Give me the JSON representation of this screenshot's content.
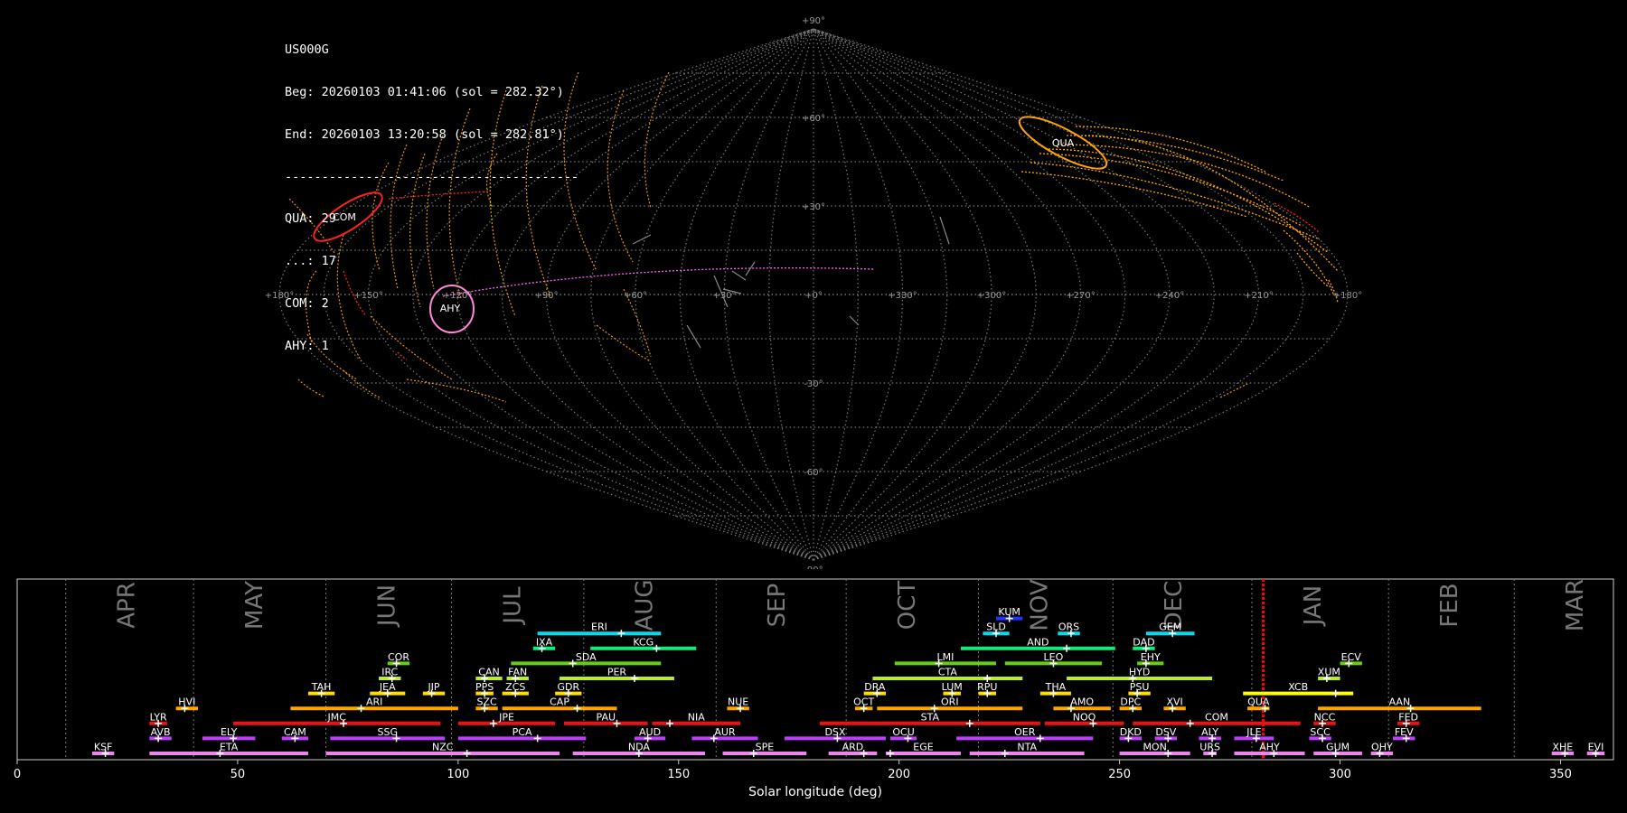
{
  "info": {
    "station": "US000G",
    "begin": "Beg: 20260103 01:41:06 (sol = 282.32°)",
    "end": "End: 20260103 13:20:58 (sol = 282.81°)",
    "divider": "----------------------------------------",
    "counts": [
      "QUA: 29",
      "...: 17",
      "COM: 2",
      "AHY: 1"
    ]
  },
  "sky": {
    "lon_labels": [
      "+180°",
      "+150°",
      "+120°",
      "+90°",
      "+60°",
      "+30°",
      "+0°",
      "+330°",
      "+300°",
      "+270°",
      "+240°",
      "+210°",
      "+180°"
    ],
    "lat_labels": [
      "+90°",
      "+60°",
      "+30°",
      "-30°",
      "-60°",
      "-90°"
    ],
    "radiants": [
      {
        "code": "QUA",
        "color": "#ffa500"
      },
      {
        "code": "COM",
        "color": "#ff2020"
      },
      {
        "code": "AHY",
        "color": "#ff88dd"
      }
    ]
  },
  "chart_data": {
    "type": "timeline",
    "xlabel": "Solar longitude (deg)",
    "xlim": [
      0,
      362
    ],
    "xticks": [
      0,
      50,
      100,
      150,
      200,
      250,
      300,
      350
    ],
    "current_sol": [
      282.32,
      282.81
    ],
    "months": [
      {
        "name": "APR",
        "boundary": 11
      },
      {
        "name": "MAY",
        "boundary": 40
      },
      {
        "name": "JUN",
        "boundary": 70
      },
      {
        "name": "JUL",
        "boundary": 98.5
      },
      {
        "name": "AUG",
        "boundary": 128.5
      },
      {
        "name": "SEP",
        "boundary": 158.5
      },
      {
        "name": "OCT",
        "boundary": 188
      },
      {
        "name": "NOV",
        "boundary": 218
      },
      {
        "name": "DEC",
        "boundary": 248.5
      },
      {
        "name": "JAN",
        "boundary": 280
      },
      {
        "name": "FEB",
        "boundary": 311
      },
      {
        "name": "MAR",
        "boundary": 339.5
      }
    ],
    "showers": [
      {
        "code": "KSF",
        "start": 17,
        "end": 22,
        "peak": 20,
        "row": 0,
        "color": "#ee82ee"
      },
      {
        "code": "ETA",
        "start": 30,
        "end": 66,
        "peak": 46,
        "row": 0,
        "color": "#ee82ee"
      },
      {
        "code": "NZC",
        "start": 70,
        "end": 123,
        "peak": 102,
        "row": 0,
        "color": "#ee82ee"
      },
      {
        "code": "NDA",
        "start": 126,
        "end": 156,
        "peak": 141,
        "row": 0,
        "color": "#ee82ee"
      },
      {
        "code": "SPE",
        "start": 160,
        "end": 179,
        "peak": 167,
        "row": 0,
        "color": "#ee82ee"
      },
      {
        "code": "ARD",
        "start": 184,
        "end": 195,
        "peak": 192,
        "row": 0,
        "color": "#ee82ee"
      },
      {
        "code": "EGE",
        "start": 197,
        "end": 214,
        "peak": 198,
        "row": 0,
        "color": "#ee82ee"
      },
      {
        "code": "NTA",
        "start": 216,
        "end": 242,
        "peak": 224,
        "row": 0,
        "color": "#ee82ee"
      },
      {
        "code": "MON",
        "start": 250,
        "end": 266,
        "peak": 261,
        "row": 0,
        "color": "#ee82ee"
      },
      {
        "code": "URS",
        "start": 269,
        "end": 272,
        "peak": 271,
        "row": 0,
        "color": "#ee82ee"
      },
      {
        "code": "AHY",
        "start": 276,
        "end": 292,
        "peak": 285,
        "row": 0,
        "color": "#ee82ee"
      },
      {
        "code": "GUM",
        "start": 294,
        "end": 305,
        "peak": 299,
        "row": 0,
        "color": "#ee82ee"
      },
      {
        "code": "OHY",
        "start": 307,
        "end": 312,
        "peak": 309,
        "row": 0,
        "color": "#ee82ee"
      },
      {
        "code": "XHE",
        "start": 348,
        "end": 353,
        "peak": 351,
        "row": 0,
        "color": "#ee82ee"
      },
      {
        "code": "EVI",
        "start": 356,
        "end": 360,
        "peak": 358,
        "row": 0,
        "color": "#ee82ee"
      },
      {
        "code": "AVB",
        "start": 30,
        "end": 35,
        "peak": 32,
        "row": 1,
        "color": "#c03cff"
      },
      {
        "code": "ELY",
        "start": 42,
        "end": 54,
        "peak": 49,
        "row": 1,
        "color": "#c03cff"
      },
      {
        "code": "CAM",
        "start": 60,
        "end": 66,
        "peak": 63,
        "row": 1,
        "color": "#c03cff"
      },
      {
        "code": "SSG",
        "start": 71,
        "end": 97,
        "peak": 86,
        "row": 1,
        "color": "#c03cff"
      },
      {
        "code": "PCA",
        "start": 100,
        "end": 129,
        "peak": 118,
        "row": 1,
        "color": "#c03cff"
      },
      {
        "code": "AUD",
        "start": 140,
        "end": 147,
        "peak": 143,
        "row": 1,
        "color": "#c03cff"
      },
      {
        "code": "AUR",
        "start": 153,
        "end": 168,
        "peak": 158,
        "row": 1,
        "color": "#c03cff"
      },
      {
        "code": "DSX",
        "start": 174,
        "end": 197,
        "peak": 186,
        "row": 1,
        "color": "#c03cff"
      },
      {
        "code": "OCU",
        "start": 198,
        "end": 204,
        "peak": 202,
        "row": 1,
        "color": "#c03cff"
      },
      {
        "code": "OER",
        "start": 213,
        "end": 244,
        "peak": 232,
        "row": 1,
        "color": "#c03cff"
      },
      {
        "code": "DKD",
        "start": 250,
        "end": 255,
        "peak": 252,
        "row": 1,
        "color": "#c03cff"
      },
      {
        "code": "DSV",
        "start": 258,
        "end": 263,
        "peak": 261,
        "row": 1,
        "color": "#c03cff"
      },
      {
        "code": "ALY",
        "start": 268,
        "end": 273,
        "peak": 271,
        "row": 1,
        "color": "#c03cff"
      },
      {
        "code": "JLE",
        "start": 276,
        "end": 285,
        "peak": 281,
        "row": 1,
        "color": "#c03cff"
      },
      {
        "code": "SCC",
        "start": 293,
        "end": 298,
        "peak": 296,
        "row": 1,
        "color": "#c03cff"
      },
      {
        "code": "FEV",
        "start": 312,
        "end": 317,
        "peak": 315,
        "row": 1,
        "color": "#c03cff"
      },
      {
        "code": "LYR",
        "start": 30,
        "end": 34,
        "peak": 32,
        "row": 2,
        "color": "#ee1111"
      },
      {
        "code": "JMC",
        "start": 49,
        "end": 96,
        "peak": 74,
        "row": 2,
        "color": "#ee1111"
      },
      {
        "code": "JPE",
        "start": 100,
        "end": 122,
        "peak": 108,
        "row": 2,
        "color": "#ee1111"
      },
      {
        "code": "PAU",
        "start": 124,
        "end": 143,
        "peak": 136,
        "row": 2,
        "color": "#ee1111"
      },
      {
        "code": "NIA",
        "start": 144,
        "end": 164,
        "peak": 148,
        "row": 2,
        "color": "#ee1111"
      },
      {
        "code": "STA",
        "start": 182,
        "end": 232,
        "peak": 216,
        "row": 2,
        "color": "#ee1111"
      },
      {
        "code": "NOO",
        "start": 233,
        "end": 251,
        "peak": 244,
        "row": 2,
        "color": "#ee1111"
      },
      {
        "code": "COM",
        "start": 253,
        "end": 291,
        "peak": 266,
        "row": 2,
        "color": "#ee1111"
      },
      {
        "code": "NCC",
        "start": 294,
        "end": 299,
        "peak": 296,
        "row": 2,
        "color": "#ee1111"
      },
      {
        "code": "FED",
        "start": 313,
        "end": 318,
        "peak": 315,
        "row": 2,
        "color": "#ee1111"
      },
      {
        "code": "HVI",
        "start": 36,
        "end": 41,
        "peak": 38,
        "row": 3,
        "color": "#ffa500"
      },
      {
        "code": "ARI",
        "start": 62,
        "end": 100,
        "peak": 78,
        "row": 3,
        "color": "#ffa500"
      },
      {
        "code": "SZC",
        "start": 104,
        "end": 109,
        "peak": 106,
        "row": 3,
        "color": "#ffa500"
      },
      {
        "code": "CAP",
        "start": 110,
        "end": 136,
        "peak": 127,
        "row": 3,
        "color": "#ffa500"
      },
      {
        "code": "NUE",
        "start": 161,
        "end": 166,
        "peak": 164,
        "row": 3,
        "color": "#ffa500"
      },
      {
        "code": "OCT",
        "start": 190,
        "end": 194,
        "peak": 192,
        "row": 3,
        "color": "#ffa500"
      },
      {
        "code": "ORI",
        "start": 195,
        "end": 228,
        "peak": 208,
        "row": 3,
        "color": "#ffa500"
      },
      {
        "code": "AMO",
        "start": 235,
        "end": 248,
        "peak": 239,
        "row": 3,
        "color": "#ffa500"
      },
      {
        "code": "DPC",
        "start": 250,
        "end": 255,
        "peak": 253,
        "row": 3,
        "color": "#ffa500"
      },
      {
        "code": "XVI",
        "start": 260,
        "end": 265,
        "peak": 262,
        "row": 3,
        "color": "#ffa500"
      },
      {
        "code": "QUA",
        "start": 279,
        "end": 284,
        "peak": 283,
        "row": 3,
        "color": "#ffa500"
      },
      {
        "code": "AAN",
        "start": 295,
        "end": 332,
        "peak": 316,
        "row": 3,
        "color": "#ffa500"
      },
      {
        "code": "TAH",
        "start": 66,
        "end": 72,
        "peak": 69,
        "row": 4,
        "color": "#ffdd00"
      },
      {
        "code": "JEA",
        "start": 80,
        "end": 88,
        "peak": 84,
        "row": 4,
        "color": "#ffdd00"
      },
      {
        "code": "JIP",
        "start": 92,
        "end": 97,
        "peak": 94,
        "row": 4,
        "color": "#ffdd00"
      },
      {
        "code": "PPS",
        "start": 104,
        "end": 108,
        "peak": 106,
        "row": 4,
        "color": "#ffdd00"
      },
      {
        "code": "ZCS",
        "start": 110,
        "end": 116,
        "peak": 113,
        "row": 4,
        "color": "#ffdd00"
      },
      {
        "code": "GDR",
        "start": 122,
        "end": 128,
        "peak": 125,
        "row": 4,
        "color": "#ffdd00"
      },
      {
        "code": "DRA",
        "start": 192,
        "end": 197,
        "peak": 195,
        "row": 4,
        "color": "#ffdd00"
      },
      {
        "code": "LUM",
        "start": 210,
        "end": 214,
        "peak": 212,
        "row": 4,
        "color": "#ffdd00"
      },
      {
        "code": "RPU",
        "start": 218,
        "end": 222,
        "peak": 220,
        "row": 4,
        "color": "#ffdd00"
      },
      {
        "code": "THA",
        "start": 232,
        "end": 239,
        "peak": 235,
        "row": 4,
        "color": "#ffdd00"
      },
      {
        "code": "PSU",
        "start": 252,
        "end": 257,
        "peak": 254,
        "row": 4,
        "color": "#ffdd00"
      },
      {
        "code": "XCB",
        "start": 278,
        "end": 303,
        "peak": 299,
        "row": 4,
        "color": "#ffff00"
      },
      {
        "code": "IRC",
        "start": 82,
        "end": 87,
        "peak": 85,
        "row": 5,
        "color": "#bbee22"
      },
      {
        "code": "CAN",
        "start": 104,
        "end": 110,
        "peak": 106,
        "row": 5,
        "color": "#bbee22"
      },
      {
        "code": "FAN",
        "start": 111,
        "end": 116,
        "peak": 113,
        "row": 5,
        "color": "#bbee22"
      },
      {
        "code": "PER",
        "start": 123,
        "end": 149,
        "peak": 140,
        "row": 5,
        "color": "#bbee22"
      },
      {
        "code": "CTA",
        "start": 194,
        "end": 228,
        "peak": 220,
        "row": 5,
        "color": "#bbee22"
      },
      {
        "code": "HYD",
        "start": 238,
        "end": 271,
        "peak": 253,
        "row": 5,
        "color": "#bbee22"
      },
      {
        "code": "XUM",
        "start": 295,
        "end": 300,
        "peak": 297,
        "row": 5,
        "color": "#bbee22"
      },
      {
        "code": "COR",
        "start": 84,
        "end": 89,
        "peak": 86,
        "row": 6,
        "color": "#66cc22"
      },
      {
        "code": "SDA",
        "start": 112,
        "end": 146,
        "peak": 126,
        "row": 6,
        "color": "#66cc22"
      },
      {
        "code": "LMI",
        "start": 199,
        "end": 222,
        "peak": 209,
        "row": 6,
        "color": "#66cc22"
      },
      {
        "code": "LEO",
        "start": 224,
        "end": 246,
        "peak": 235,
        "row": 6,
        "color": "#66cc22"
      },
      {
        "code": "EHY",
        "start": 254,
        "end": 260,
        "peak": 256,
        "row": 6,
        "color": "#66cc22"
      },
      {
        "code": "ECV",
        "start": 300,
        "end": 305,
        "peak": 302,
        "row": 6,
        "color": "#66cc22"
      },
      {
        "code": "IXA",
        "start": 117,
        "end": 122,
        "peak": 119,
        "row": 7,
        "color": "#11ee77"
      },
      {
        "code": "KCG",
        "start": 130,
        "end": 154,
        "peak": 145,
        "row": 7,
        "color": "#11ee77"
      },
      {
        "code": "AND",
        "start": 214,
        "end": 249,
        "peak": 238,
        "row": 7,
        "color": "#11ee77"
      },
      {
        "code": "DAD",
        "start": 253,
        "end": 258,
        "peak": 256,
        "row": 7,
        "color": "#11ee77"
      },
      {
        "code": "ERI",
        "start": 118,
        "end": 146,
        "peak": 137,
        "row": 8,
        "color": "#00ddee"
      },
      {
        "code": "SLD",
        "start": 219,
        "end": 225,
        "peak": 222,
        "row": 8,
        "color": "#00ddee"
      },
      {
        "code": "ORS",
        "start": 236,
        "end": 241,
        "peak": 239,
        "row": 8,
        "color": "#00ddee"
      },
      {
        "code": "GEM",
        "start": 256,
        "end": 267,
        "peak": 262,
        "row": 8,
        "color": "#00ddee"
      },
      {
        "code": "KUM",
        "start": 222,
        "end": 228,
        "peak": 225,
        "row": 9,
        "color": "#2233ff"
      }
    ]
  }
}
